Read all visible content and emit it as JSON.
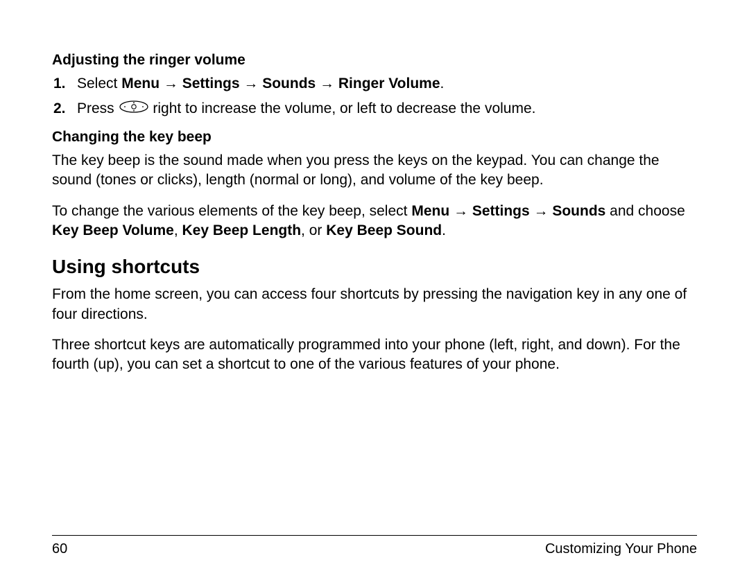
{
  "section1": {
    "heading": "Adjusting the ringer volume",
    "step1_num": "1.",
    "step1_prefix": "Select ",
    "step1_path": "Menu → Settings → Sounds → Ringer Volume",
    "step1_suffix": ".",
    "step2_num": "2.",
    "step2_prefix": "Press ",
    "step2_suffix": " right to increase the volume, or left to decrease the volume."
  },
  "section2": {
    "heading": "Changing the key beep",
    "para1": "The key beep is the sound made when you press the keys on the keypad. You can change the sound (tones or clicks), length (normal or long), and volume of the key beep.",
    "para2_a": "To change the various elements of the key beep, select ",
    "para2_b": "Menu → Settings → Sounds",
    "para2_c": " and choose ",
    "para2_d": "Key Beep Volume",
    "para2_e": ", ",
    "para2_f": "Key Beep Length",
    "para2_g": ", or ",
    "para2_h": "Key Beep Sound",
    "para2_i": "."
  },
  "section3": {
    "heading": "Using shortcuts",
    "para1": "From the home screen, you can access four shortcuts by pressing the navigation key in any one of four directions.",
    "para2": "Three shortcut keys are automatically programmed into your phone (left, right, and down). For the fourth (up), you can set a shortcut to one of the various features of your phone."
  },
  "footer": {
    "page": "60",
    "title": "Customizing Your Phone"
  }
}
